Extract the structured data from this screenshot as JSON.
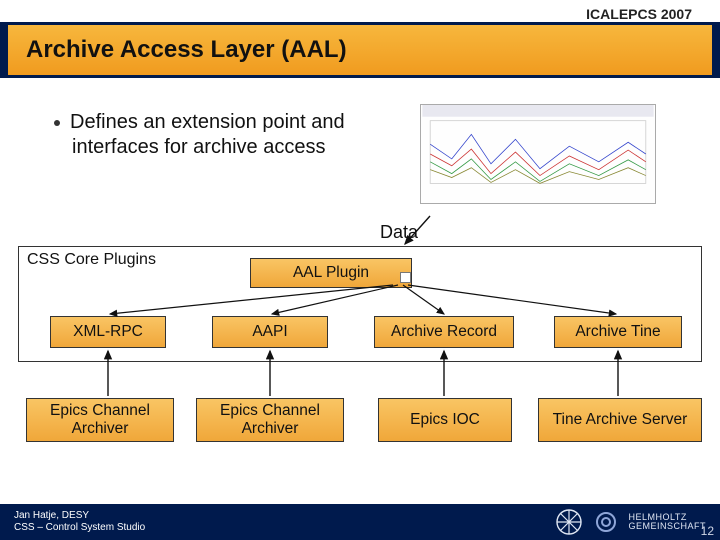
{
  "header": {
    "conference": "ICALEPCS 2007"
  },
  "title": "Archive Access Layer (AAL)",
  "bullet": "Defines an extension point and interfaces for archive access",
  "labels": {
    "data": "Data",
    "core_plugins": "CSS Core Plugins",
    "aal_plugin": "AAL Plugin"
  },
  "middleware": {
    "xml_rpc": "XML-RPC",
    "aapi": "AAPI",
    "archive_record": "Archive Record",
    "archive_tine": "Archive Tine"
  },
  "servers": {
    "eca1": "Epics Channel Archiver",
    "eca2": "Epics Channel Archiver",
    "eioc": "Epics IOC",
    "tine": "Tine Archive Server"
  },
  "footer": {
    "author": "Jan Hatje, DESY",
    "subtitle": "CSS – Control System Studio",
    "helmholtz_top": "HELMHOLTZ",
    "helmholtz_bottom": "GEMEINSCHAFT",
    "page": "12"
  }
}
